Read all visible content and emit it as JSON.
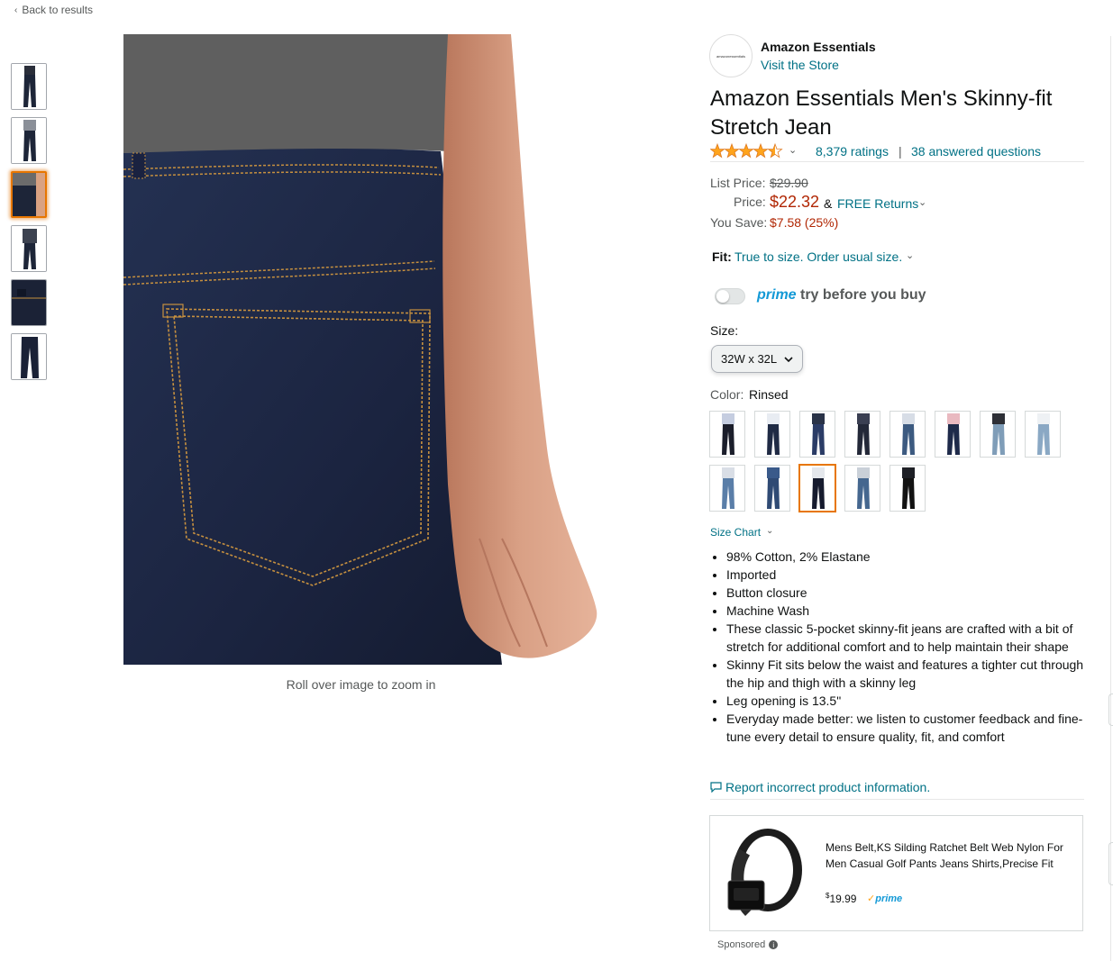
{
  "nav": {
    "back_label": "Back to results"
  },
  "gallery": {
    "thumbnails": [
      "front",
      "front-shirt",
      "back-pocket",
      "full-outfit",
      "fabric-detail",
      "flat-lay"
    ],
    "selected_index": 2,
    "zoom_hint": "Roll over image to zoom in"
  },
  "store": {
    "logo_text": "amazonessentials",
    "brand": "Amazon Essentials",
    "visit_label": "Visit the Store"
  },
  "product": {
    "title": "Amazon Essentials Men's Skinny-fit Stretch Jean",
    "rating_stars": 4.5,
    "ratings_count": "8,379 ratings",
    "separator": "|",
    "answered": "38 answered questions"
  },
  "pricing": {
    "list_label": "List Price:",
    "list_value": "$29.90",
    "price_label": "Price:",
    "price_value": "$22.32",
    "amp": "&",
    "returns": "FREE Returns",
    "save_label": "You Save:",
    "save_value": "$7.58 (25%)"
  },
  "fit": {
    "label": "Fit:",
    "value": "True to size. Order usual size."
  },
  "prime_try": {
    "prime": "prime",
    "text": "try before you buy",
    "enabled": false
  },
  "size": {
    "label": "Size:",
    "selected": "32W x 32L"
  },
  "color": {
    "label": "Color:",
    "selected": "Rinsed",
    "swatches": [
      {
        "top": "#c5cde0",
        "jean": "#1b1e2b"
      },
      {
        "top": "#e8ecf2",
        "jean": "#1f2a44"
      },
      {
        "top": "#2a3348",
        "jean": "#2b3c66"
      },
      {
        "top": "#3a3f52",
        "jean": "#232838"
      },
      {
        "top": "#d7dde6",
        "jean": "#3c5a80"
      },
      {
        "top": "#e9b9c0",
        "jean": "#1e2a4a"
      },
      {
        "top": "#2d2f36",
        "jean": "#7f9db8"
      },
      {
        "top": "#eef1f4",
        "jean": "#8aa8c4"
      },
      {
        "top": "#d9dee6",
        "jean": "#5a7ea8"
      },
      {
        "top": "#3a5a8a",
        "jean": "#2f4a74"
      },
      {
        "top": "#e4e7ec",
        "jean": "#161b2e"
      },
      {
        "top": "#c9d0d8",
        "jean": "#45678f"
      },
      {
        "top": "#1e2026",
        "jean": "#121212"
      }
    ],
    "selected_index": 10
  },
  "size_chart_label": "Size Chart",
  "bullets": [
    "98% Cotton, 2% Elastane",
    "Imported",
    "Button closure",
    "Machine Wash",
    "These classic 5-pocket skinny-fit jeans are crafted with a bit of stretch for additional comfort and to help maintain their shape",
    "Skinny Fit sits below the waist and features a tighter cut through the hip and thigh with a skinny leg",
    "Leg opening is 13.5\"",
    "Everyday made better: we listen to customer feedback and fine-tune every detail to ensure quality, fit, and comfort"
  ],
  "report_label": "Report incorrect product information.",
  "ad": {
    "title": "Mens Belt,KS Silding Ratchet Belt Web Nylon For Men Casual Golf Pants Jeans Shirts,Precise Fit",
    "price_symbol": "$",
    "price_value": "19.99",
    "prime": "prime",
    "sponsored": "Sponsored"
  },
  "colors": {
    "link": "#007185",
    "price_red": "#b12704",
    "selected_orange": "#e77600",
    "prime_blue": "#1399d6",
    "star": "#ffa41c"
  }
}
